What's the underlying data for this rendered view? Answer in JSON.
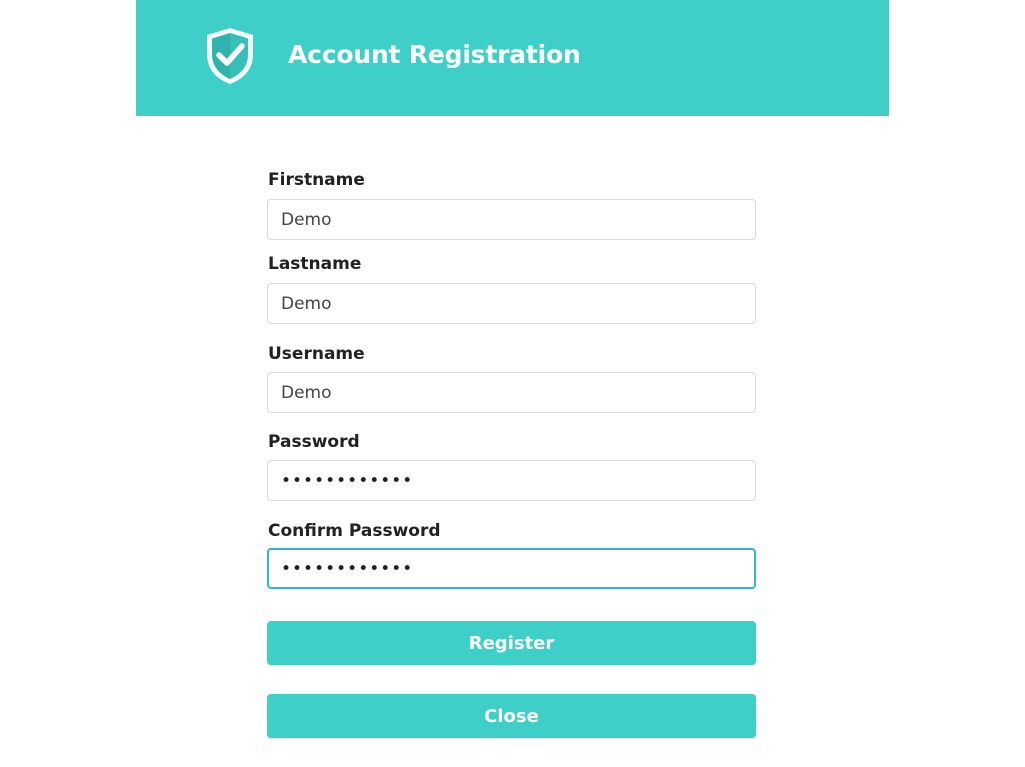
{
  "header": {
    "title": "Account Registration",
    "icon": "shield-check-icon",
    "background": "#3dcfc8"
  },
  "form": {
    "firstname": {
      "label": "Firstname",
      "value": "Demo"
    },
    "lastname": {
      "label": "Lastname",
      "value": "Demo"
    },
    "username": {
      "label": "Username",
      "value": "Demo"
    },
    "password": {
      "label": "Password",
      "value": "••••••••••••"
    },
    "confirm_password": {
      "label": "Confirm Password",
      "value": "••••••••••••"
    }
  },
  "buttons": {
    "register_label": "Register",
    "close_label": "Close"
  },
  "colors": {
    "accent": "#3dcfc8",
    "focus_border": "#2fb8cf",
    "label_text": "#222222"
  }
}
